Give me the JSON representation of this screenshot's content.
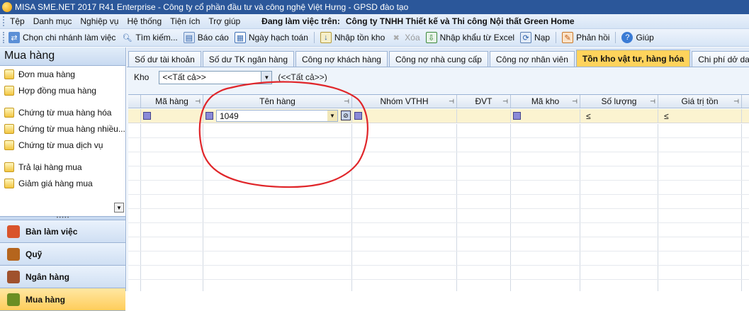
{
  "window": {
    "title": "MISA SME.NET 2017 R41 Enterprise - Công ty cổ phần đầu tư và công nghệ Việt Hưng - GPSD đào tạo"
  },
  "menu": {
    "items": [
      "Tệp",
      "Danh mục",
      "Nghiệp vụ",
      "Hệ thống",
      "Tiện ích",
      "Trợ giúp"
    ],
    "work_label": "Đang làm việc trên:",
    "company": "Công ty TNHH Thiết kế và Thi công Nội thất Green Home"
  },
  "toolbar": {
    "items": [
      {
        "label": "Chọn chi nhánh làm việc",
        "icon": "branch-icon"
      },
      {
        "label": "Tìm kiếm...",
        "icon": "search-icon"
      },
      {
        "label": "Báo cáo",
        "icon": "report-icon"
      },
      {
        "label": "Ngày hạch toán",
        "icon": "calendar-icon"
      },
      {
        "label": "Nhập tồn kho",
        "icon": "import-stock-icon"
      },
      {
        "label": "Xóa",
        "icon": "delete-icon",
        "disabled": true
      },
      {
        "label": "Nhập khẩu từ Excel",
        "icon": "excel-icon"
      },
      {
        "label": "Nạp",
        "icon": "refresh-icon"
      },
      {
        "label": "Phản hồi",
        "icon": "feedback-icon"
      },
      {
        "label": "Giúp",
        "icon": "help-icon"
      }
    ]
  },
  "sidebar": {
    "title": "Mua hàng",
    "items": [
      "Đơn mua hàng",
      "Hợp đồng mua hàng",
      "Chứng từ mua hàng hóa",
      "Chứng từ mua hàng nhiều...",
      "Chứng từ mua dịch vụ",
      "Trả lại hàng mua",
      "Giảm giá hàng mua"
    ],
    "nav": [
      {
        "label": "Bàn làm việc",
        "color": "#d9542b"
      },
      {
        "label": "Quỹ",
        "color": "#b5651d"
      },
      {
        "label": "Ngân hàng",
        "color": "#a0522d"
      },
      {
        "label": "Mua hàng",
        "color": "#6b8e23",
        "active": true
      }
    ]
  },
  "tabs": [
    "Số dư tài khoản",
    "Số dư TK ngân hàng",
    "Công nợ khách hàng",
    "Công nợ nhà cung cấp",
    "Công nợ nhân viên",
    "Tồn kho vật tư, hàng hóa",
    "Chi phí dở dang"
  ],
  "active_tab": "Tồn kho vật tư, hàng hóa",
  "filter": {
    "label": "Kho",
    "value": "<<Tất cả>>",
    "display": "(<<Tất cả>>)"
  },
  "grid": {
    "columns": [
      "Mã hàng",
      "Tên hàng",
      "Nhóm VTHH",
      "ĐVT",
      "Mã kho",
      "Số lượng",
      "Giá trị tồn"
    ],
    "filter_row": {
      "ten_hang": "1049",
      "so_luong_op": "≤",
      "gia_tri_op": "≤"
    }
  },
  "annotation": {
    "color": "#e0262a"
  }
}
